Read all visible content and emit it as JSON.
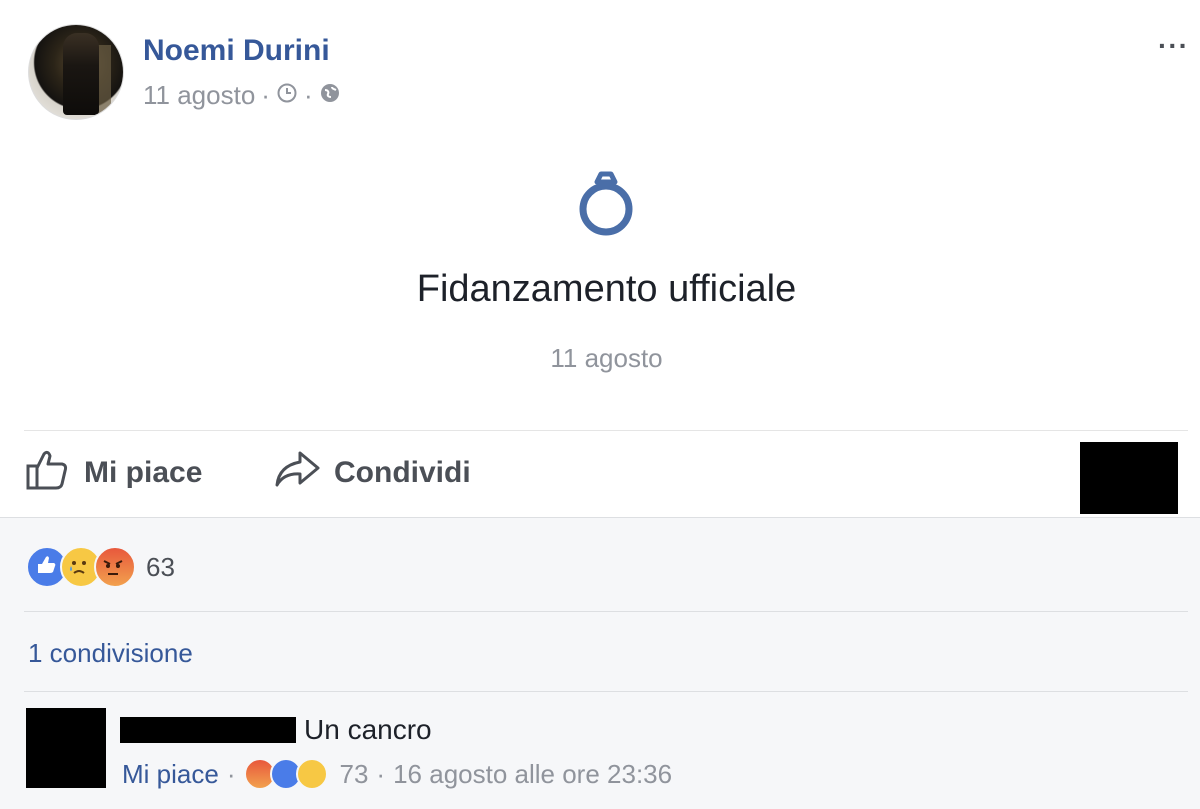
{
  "post": {
    "author": "Noemi Durini",
    "date": "11 agosto",
    "dot": "·",
    "more_label": "···"
  },
  "event": {
    "icon": "ring-icon",
    "title": "Fidanzamento ufficiale",
    "date": "11 agosto"
  },
  "actions": {
    "like_label": "Mi piace",
    "share_label": "Condividi"
  },
  "reactions": {
    "types": [
      "like",
      "sad",
      "angry"
    ],
    "count": "63"
  },
  "shares": {
    "label": "1 condivisione"
  },
  "comment": {
    "text": "Un cancro",
    "like_label": "Mi piace",
    "dot": "·",
    "reaction_types": [
      "angry",
      "like",
      "haha"
    ],
    "reaction_count": "73",
    "timestamp": "16 agosto alle ore 23:36"
  },
  "colors": {
    "link_blue": "#365899",
    "ring_blue": "#4a6ea8",
    "muted_gray": "#90949c",
    "footer_bg": "#f6f7f9"
  }
}
